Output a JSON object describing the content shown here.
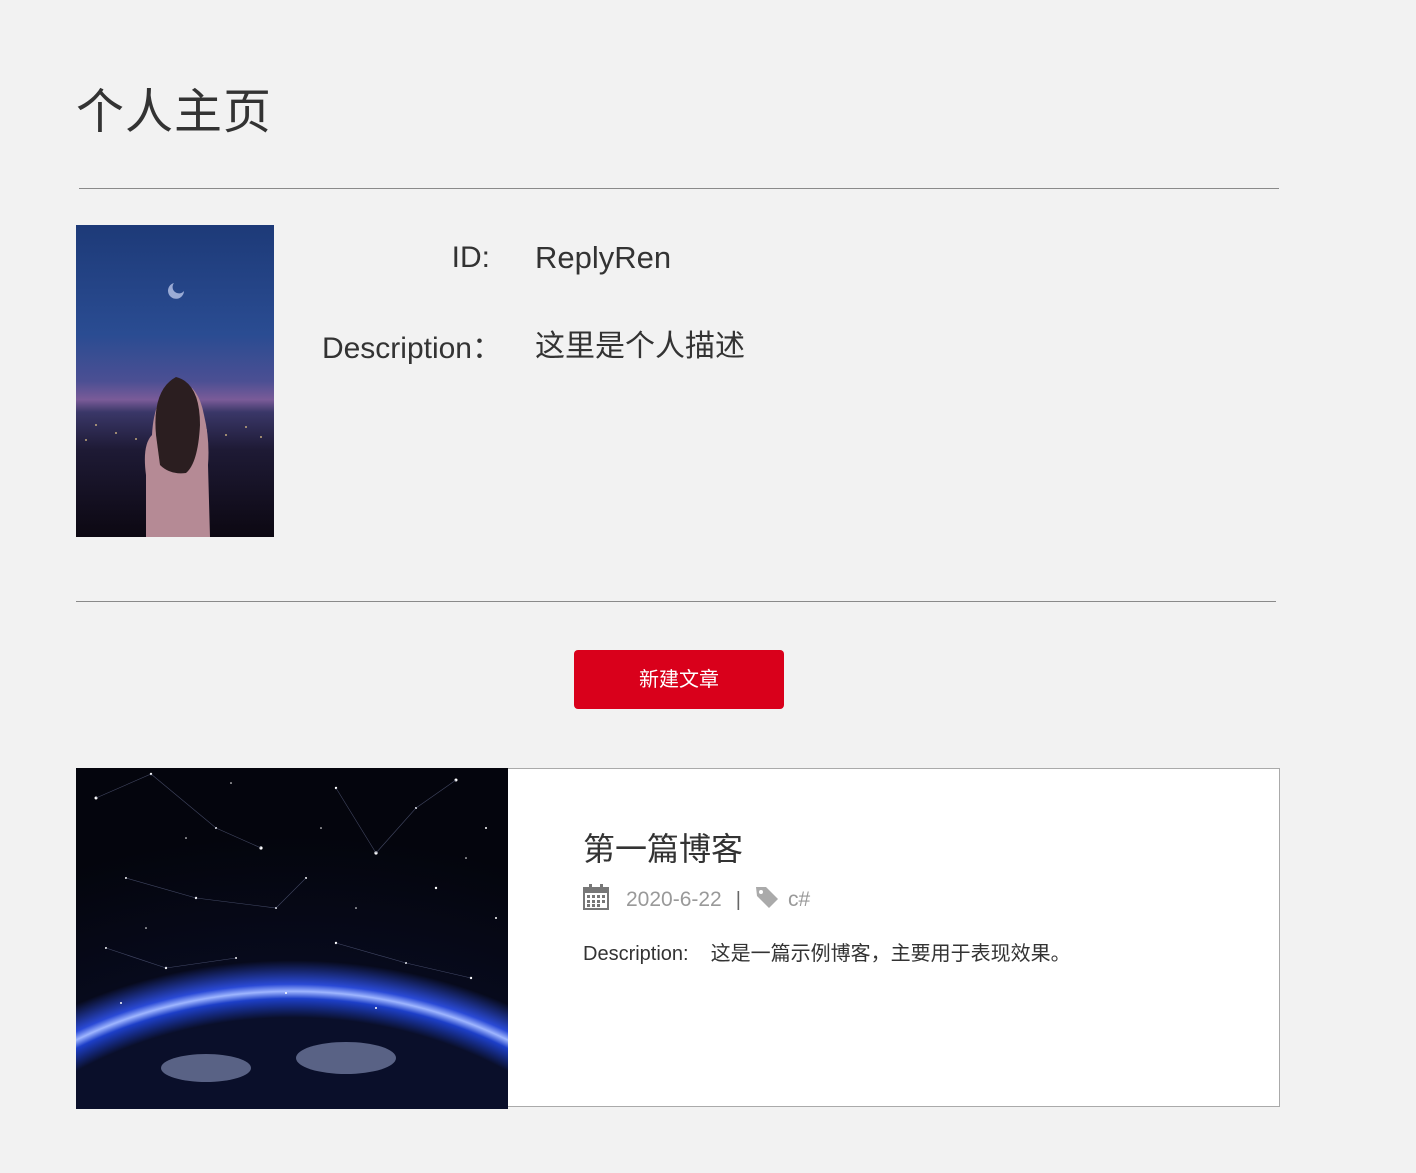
{
  "page": {
    "title": "个人主页"
  },
  "profile": {
    "id_label": "ID:",
    "id_value": "ReplyRen",
    "description_label": "Description：",
    "description_value": "这里是个人描述"
  },
  "actions": {
    "new_post_label": "新建文章"
  },
  "posts": [
    {
      "title": "第一篇博客",
      "date": "2020-6-22",
      "separator": "|",
      "tag": "c#",
      "description_label": "Description:",
      "description": "这是一篇示例博客，主要用于表现效果。"
    }
  ],
  "colors": {
    "background": "#f2f2f2",
    "accent": "#d9001b",
    "text": "#333333",
    "muted": "#999999"
  },
  "icons": {
    "date": "calendar-icon",
    "tag": "tag-icon"
  }
}
